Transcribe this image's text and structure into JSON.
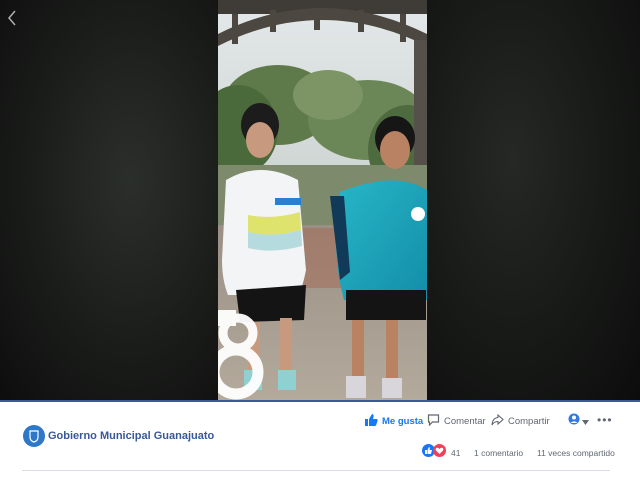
{
  "post": {
    "page_name": "Gobierno Municipal Guanajuato",
    "reactions_count": "41",
    "comments": "1 comentario",
    "shares": "11 veces compartido"
  },
  "actions": {
    "like": "Me gusta",
    "comment": "Comentar",
    "share": "Compartir"
  },
  "icons": {
    "back": "chevron-left-icon",
    "like": "thumbs-up-icon",
    "comment": "speech-bubble-icon",
    "share": "share-arrow-icon",
    "audience": "globe-icon",
    "more": "ellipsis-icon",
    "reaction_like": "like-reaction-icon",
    "reaction_love": "love-reaction-icon"
  },
  "colors": {
    "link": "#385898",
    "like_active": "#1877f2",
    "love": "#f33e58",
    "viewer_bg": "#121212",
    "divider": "#dadde1"
  }
}
